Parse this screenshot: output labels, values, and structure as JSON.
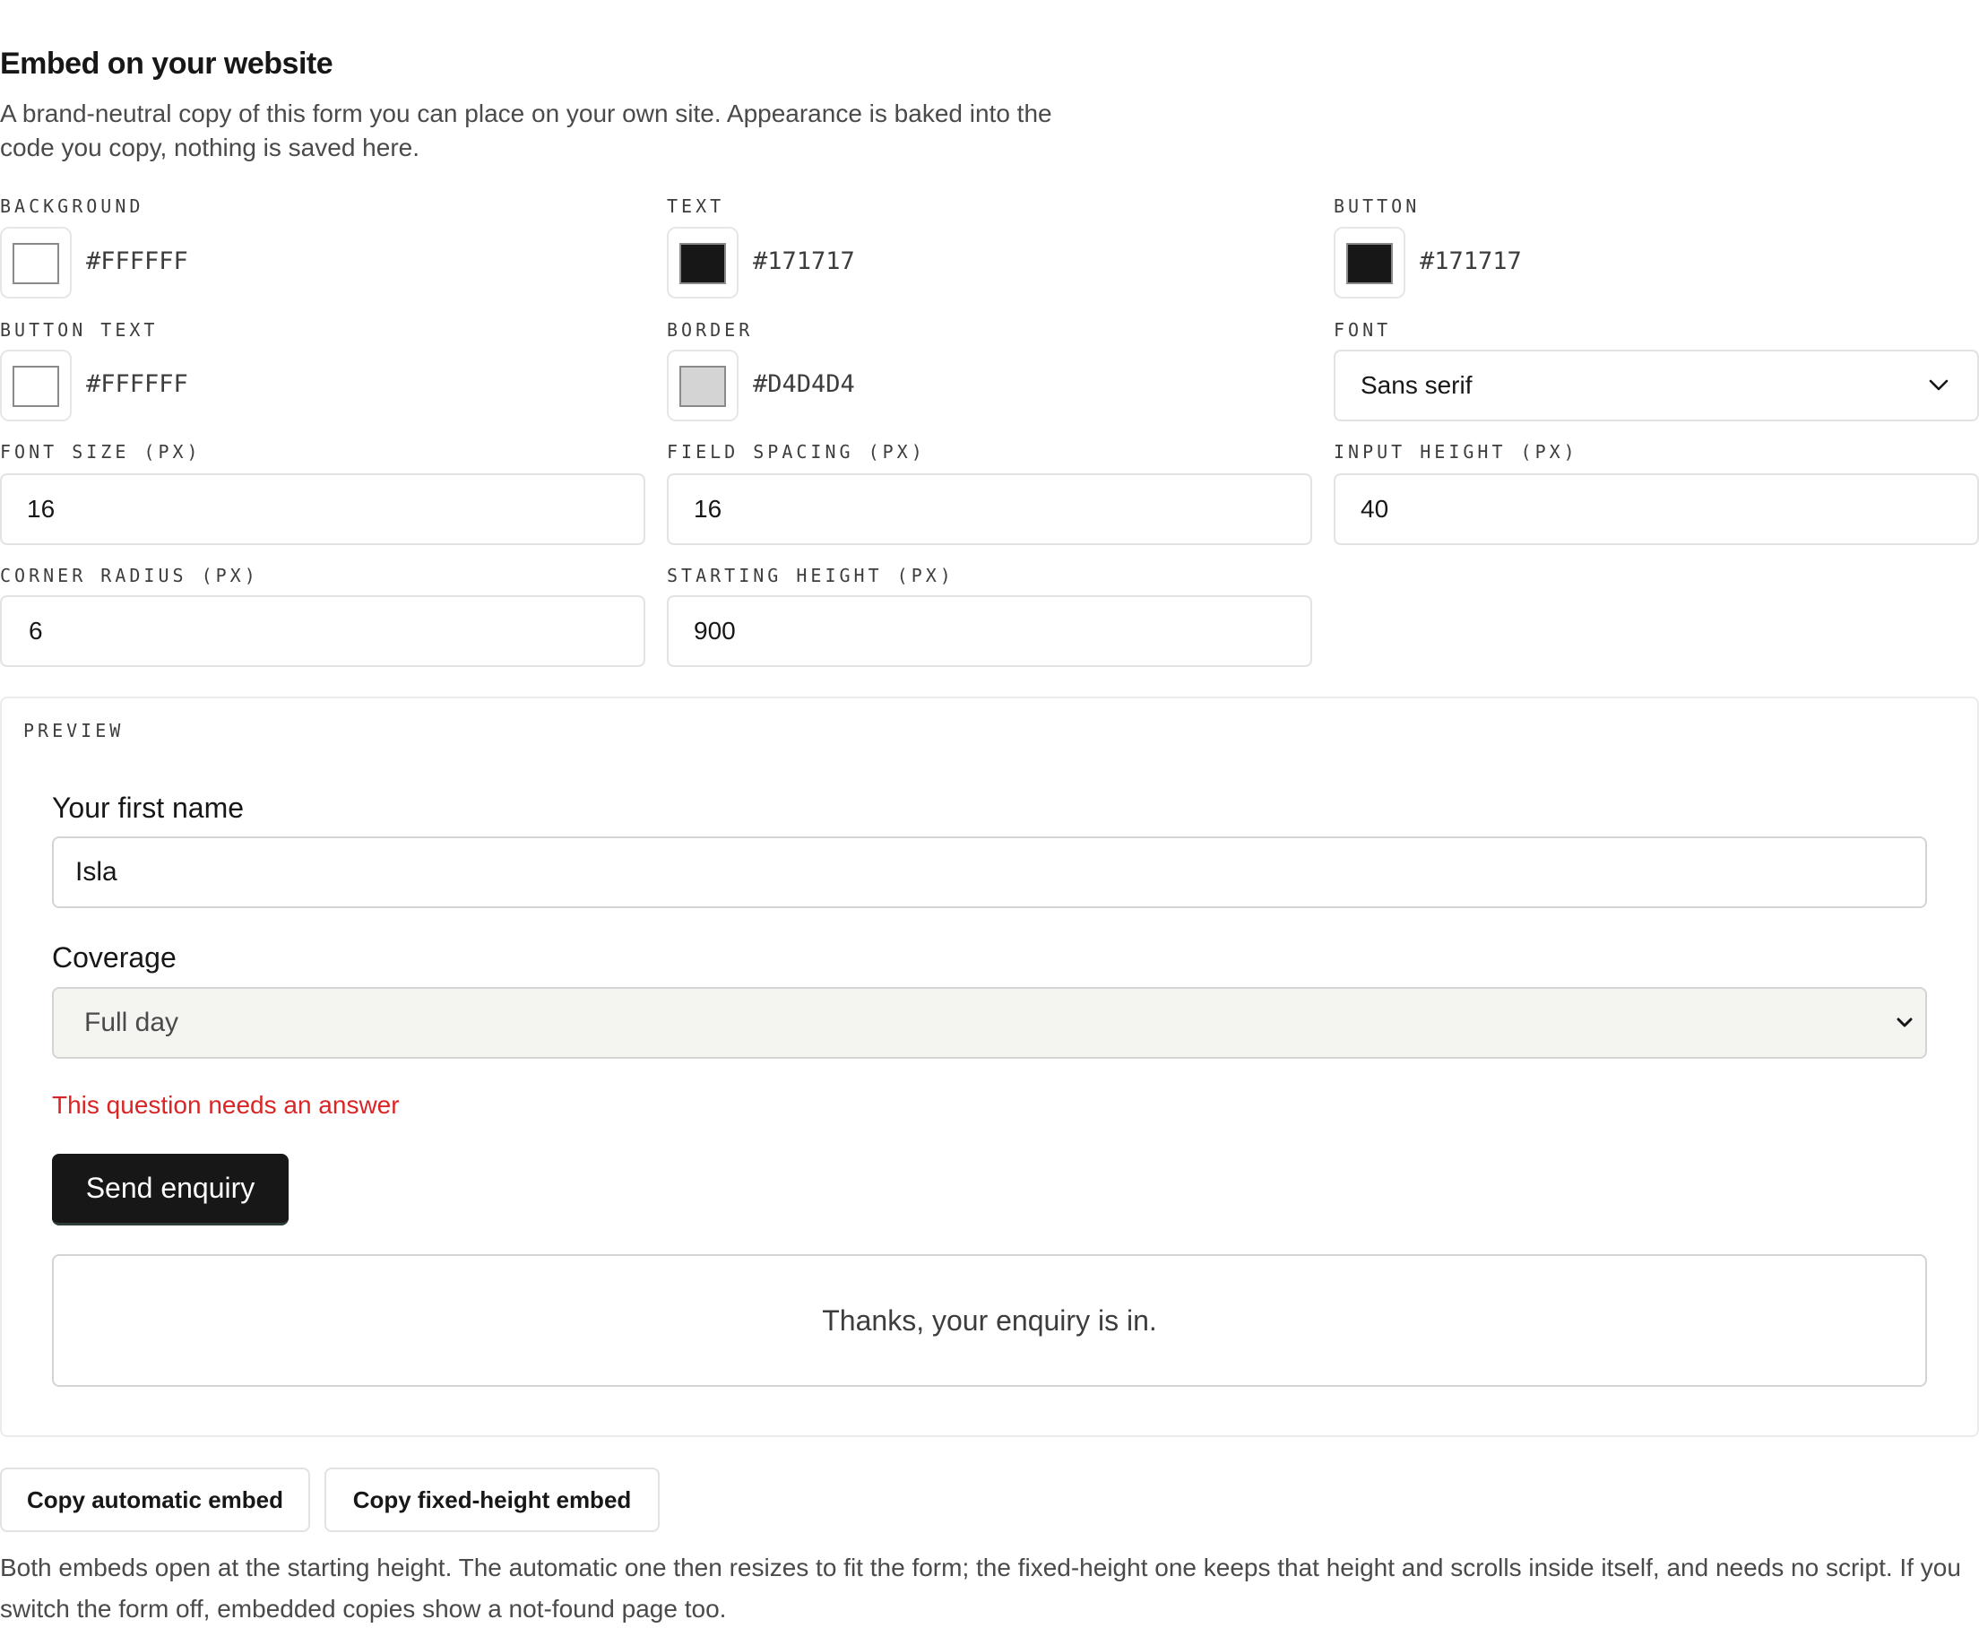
{
  "header": {
    "title": "Embed on your website",
    "description": "A brand-neutral copy of this form you can place on your own site. Appearance is baked into the code you copy, nothing is saved here."
  },
  "settings": {
    "background": {
      "label": "BACKGROUND",
      "value": "#FFFFFF",
      "color": "#FFFFFF"
    },
    "text": {
      "label": "TEXT",
      "value": "#171717",
      "color": "#171717"
    },
    "button": {
      "label": "BUTTON",
      "value": "#171717",
      "color": "#171717"
    },
    "button_text": {
      "label": "BUTTON TEXT",
      "value": "#FFFFFF",
      "color": "#FFFFFF"
    },
    "border": {
      "label": "BORDER",
      "value": "#D4D4D4",
      "color": "#D4D4D4"
    },
    "font": {
      "label": "FONT",
      "value": "Sans serif"
    },
    "font_size": {
      "label": "FONT SIZE (PX)",
      "value": "16"
    },
    "field_spacing": {
      "label": "FIELD SPACING (PX)",
      "value": "16"
    },
    "input_height": {
      "label": "INPUT HEIGHT (PX)",
      "value": "40"
    },
    "corner_radius": {
      "label": "CORNER RADIUS (PX)",
      "value": "6"
    },
    "starting_height": {
      "label": "STARTING HEIGHT (PX)",
      "value": "900"
    }
  },
  "preview": {
    "label": "PREVIEW",
    "first_name_label": "Your first name",
    "first_name_value": "Isla",
    "coverage_label": "Coverage",
    "coverage_value": "Full day",
    "error_text": "This question needs an answer",
    "error_color": "#D92525",
    "submit_label": "Send enquiry",
    "thanks_text": "Thanks, your enquiry is in."
  },
  "actions": {
    "copy_automatic": "Copy automatic embed",
    "copy_fixed": "Copy fixed-height embed"
  },
  "footer": {
    "note": "Both embeds open at the starting height. The automatic one then resizes to fit the form; the fixed-height one keeps that height and scrolls inside itself, and needs no script. If you switch the form off, embedded copies show a not-found page too."
  }
}
